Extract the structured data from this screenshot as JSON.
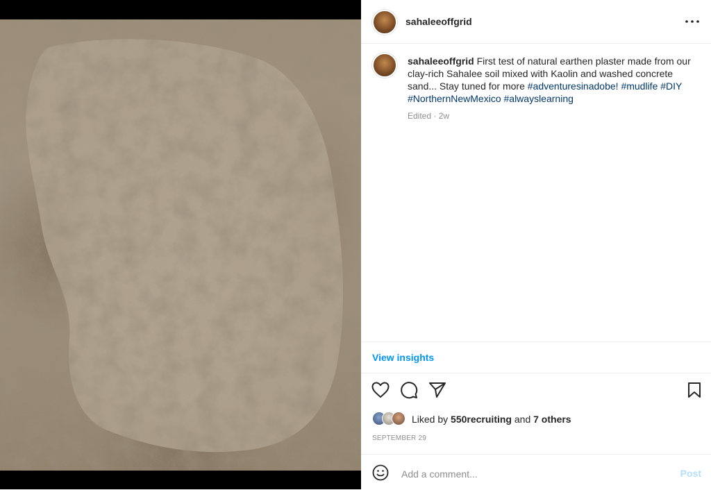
{
  "post": {
    "username": "sahaleeoffgrid",
    "more_icon": "more-horizontal-icon"
  },
  "caption": {
    "username": "sahaleeoffgrid",
    "text": "First test of natural earthen plaster made from our clay-rich Sahalee soil mixed with Kaolin and washed concrete sand... Stay tuned for more",
    "hashtags": [
      "#adventuresinadobe!",
      "#mudlife",
      "#DIY",
      "#NorthernNewMexico",
      "#alwayslearning"
    ],
    "meta": "Edited · 2w"
  },
  "insights": {
    "label": "View insights"
  },
  "actions": {
    "icons": [
      "heart-icon",
      "comment-icon",
      "share-icon",
      "bookmark-icon"
    ]
  },
  "likes": {
    "prefix": "Liked by",
    "user": "550recruiting",
    "joiner": "and",
    "others": "7 others"
  },
  "date": "SEPTEMBER 29",
  "comment": {
    "placeholder": "Add a comment...",
    "post_label": "Post"
  },
  "colors": {
    "link": "#0095f6",
    "hashtag": "#00376b",
    "muted": "#8e8e8e",
    "post_disabled": "#b2dffc"
  }
}
